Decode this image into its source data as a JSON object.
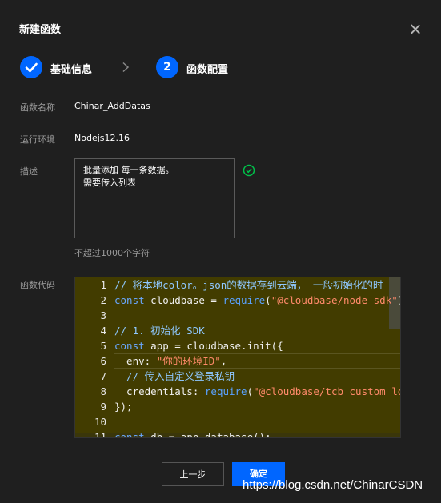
{
  "dialog": {
    "title": "新建函数"
  },
  "steps": [
    {
      "number": "1",
      "label": "基础信息",
      "status": "done"
    },
    {
      "number": "2",
      "label": "函数配置",
      "status": "active"
    }
  ],
  "form": {
    "name_label": "函数名称",
    "name_value": "Chinar_AddDatas",
    "runtime_label": "运行环境",
    "runtime_value": "Nodejs12.16",
    "desc_label": "描述",
    "desc_value": "批量添加 每一条数据。\n需要传入列表",
    "desc_hint": "不超过1000个字符",
    "code_label": "函数代码"
  },
  "code_lines": [
    {
      "num": "1",
      "segments": [
        {
          "t": "cmt",
          "v": "// 将本地color。json的数据存到云端， 一般初始化的时"
        }
      ]
    },
    {
      "num": "2",
      "segments": [
        {
          "t": "kw",
          "v": "const"
        },
        {
          "t": "plain",
          "v": " cloudbase = "
        },
        {
          "t": "fn",
          "v": "require"
        },
        {
          "t": "plain",
          "v": "("
        },
        {
          "t": "str",
          "v": "\"@cloudbase/node-sdk\""
        },
        {
          "t": "plain",
          "v": ");"
        }
      ]
    },
    {
      "num": "3",
      "segments": []
    },
    {
      "num": "4",
      "segments": [
        {
          "t": "cmt",
          "v": "// 1. 初始化 SDK"
        }
      ]
    },
    {
      "num": "5",
      "segments": [
        {
          "t": "kw",
          "v": "const"
        },
        {
          "t": "plain",
          "v": " app = cloudbase.init({"
        }
      ]
    },
    {
      "num": "6",
      "segments": [
        {
          "t": "plain",
          "v": "  env: "
        },
        {
          "t": "str",
          "v": "\"你的环境ID\""
        },
        {
          "t": "plain",
          "v": ","
        }
      ]
    },
    {
      "num": "7",
      "segments": [
        {
          "t": "cmt",
          "v": "  // 传入自定义登录私钥"
        }
      ]
    },
    {
      "num": "8",
      "segments": [
        {
          "t": "plain",
          "v": "  credentials: "
        },
        {
          "t": "fn",
          "v": "require"
        },
        {
          "t": "plain",
          "v": "("
        },
        {
          "t": "str",
          "v": "\"@cloudbase/tcb_custom_lo"
        }
      ]
    },
    {
      "num": "9",
      "segments": [
        {
          "t": "plain",
          "v": "});"
        }
      ]
    },
    {
      "num": "10",
      "segments": []
    },
    {
      "num": "11",
      "segments": [
        {
          "t": "kw",
          "v": "const"
        },
        {
          "t": "plain",
          "v": " db = app.database();"
        }
      ]
    }
  ],
  "buttons": {
    "prev_label": "上一步",
    "ok_label": "确定"
  },
  "watermark": "https://blog.csdn.net/ChinarCSDN",
  "colors": {
    "accent": "#0066ff",
    "success": "#00c24a",
    "editor_bg": "#423c00"
  },
  "icons": {
    "close": "close-icon",
    "step_done": "check-icon",
    "step_sep": "chevron-right-icon",
    "desc_valid": "check-circle-icon"
  }
}
